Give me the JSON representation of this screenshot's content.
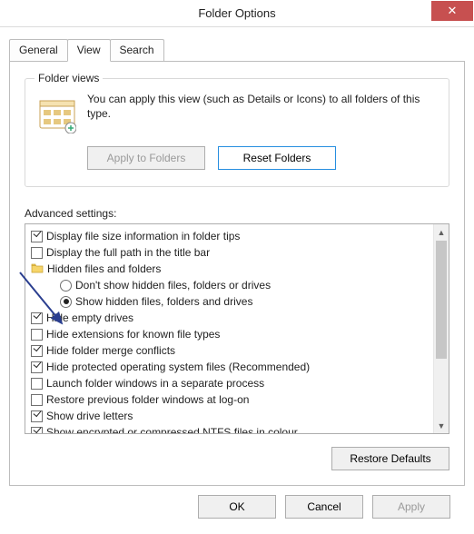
{
  "window": {
    "title": "Folder Options",
    "close_x": "✕"
  },
  "tabs": {
    "general": "General",
    "view": "View",
    "search": "Search"
  },
  "folder_views": {
    "legend": "Folder views",
    "desc": "You can apply this view (such as Details or Icons) to all folders of this type.",
    "apply_btn": "Apply to Folders",
    "reset_btn": "Reset Folders"
  },
  "advanced": {
    "label": "Advanced settings:",
    "items": [
      {
        "kind": "check",
        "checked": true,
        "label": "Display file size information in folder tips"
      },
      {
        "kind": "check",
        "checked": false,
        "label": "Display the full path in the title bar"
      },
      {
        "kind": "folder",
        "label": "Hidden files and folders"
      },
      {
        "kind": "radio",
        "indent": 2,
        "checked": false,
        "label": "Don't show hidden files, folders or drives"
      },
      {
        "kind": "radio",
        "indent": 2,
        "checked": true,
        "label": "Show hidden files, folders and drives"
      },
      {
        "kind": "check",
        "checked": true,
        "label": "Hide empty drives"
      },
      {
        "kind": "check",
        "checked": false,
        "label": "Hide extensions for known file types"
      },
      {
        "kind": "check",
        "checked": true,
        "label": "Hide folder merge conflicts"
      },
      {
        "kind": "check",
        "checked": true,
        "label": "Hide protected operating system files (Recommended)"
      },
      {
        "kind": "check",
        "checked": false,
        "label": "Launch folder windows in a separate process"
      },
      {
        "kind": "check",
        "checked": false,
        "label": "Restore previous folder windows at log-on"
      },
      {
        "kind": "check",
        "checked": true,
        "label": "Show drive letters"
      },
      {
        "kind": "check",
        "checked": true,
        "label": "Show encrypted or compressed NTFS files in colour"
      }
    ],
    "restore_btn": "Restore Defaults"
  },
  "buttons": {
    "ok": "OK",
    "cancel": "Cancel",
    "apply": "Apply"
  }
}
